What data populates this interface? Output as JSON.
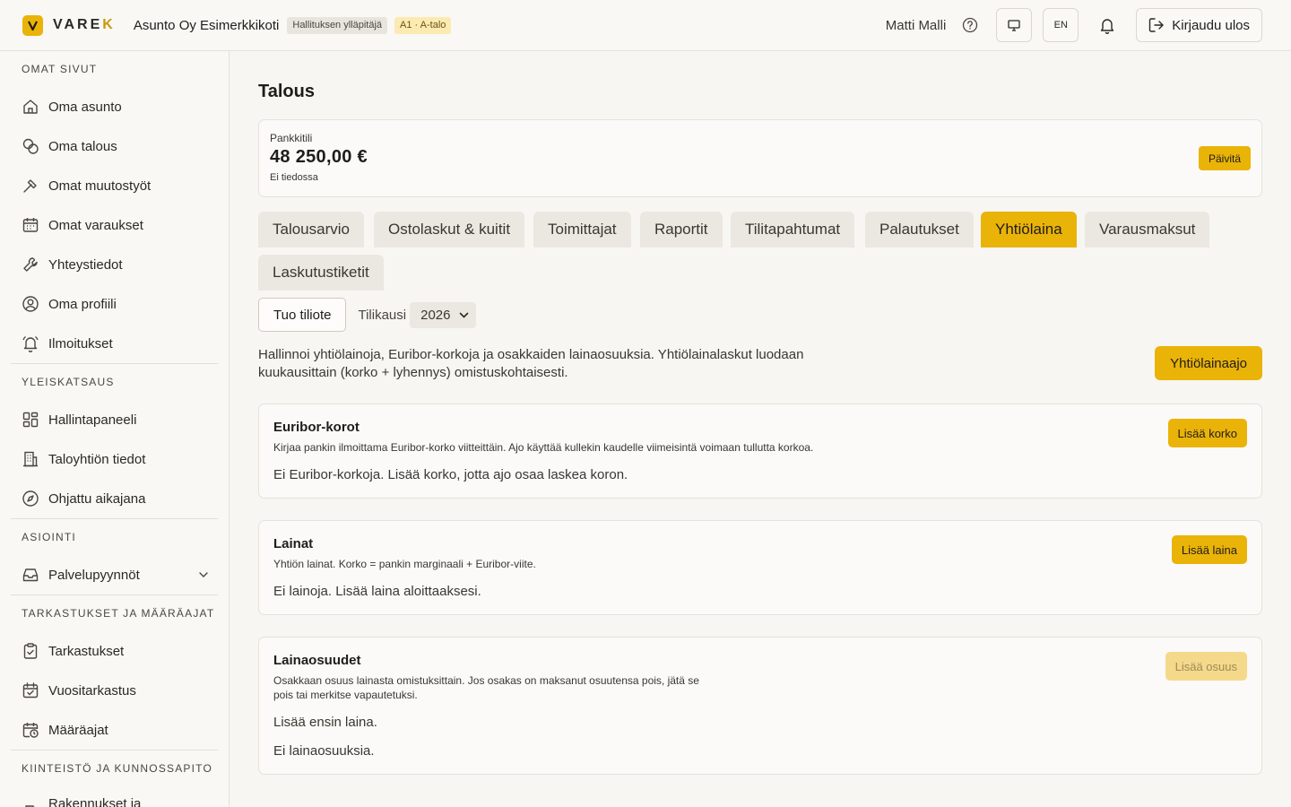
{
  "header": {
    "logo_text": "VARE",
    "logo_text_accent": "K",
    "org_name": "Asunto Oy Esimerkkikoti",
    "role_badge": "Hallituksen ylläpitäjä",
    "unit_badge": "A1 · A-talo",
    "user_name": "Matti Malli",
    "language": "EN",
    "logout_label": "Kirjaudu ulos"
  },
  "sidebar": {
    "sections": [
      {
        "title": "OMAT SIVUT",
        "items": [
          {
            "label": "Oma asunto",
            "icon": "home-icon"
          },
          {
            "label": "Oma talous",
            "icon": "coins-icon"
          },
          {
            "label": "Omat muutostyöt",
            "icon": "hammer-icon"
          },
          {
            "label": "Omat varaukset",
            "icon": "calendar-icon"
          },
          {
            "label": "Yhteystiedot",
            "icon": "wrench-icon"
          },
          {
            "label": "Oma profiili",
            "icon": "user-circle-icon"
          },
          {
            "label": "Ilmoitukset",
            "icon": "bell-ring-icon"
          }
        ]
      },
      {
        "title": "YLEISKATSAUS",
        "items": [
          {
            "label": "Hallintapaneeli",
            "icon": "dashboard-icon"
          },
          {
            "label": "Taloyhtiön tiedot",
            "icon": "building-icon"
          },
          {
            "label": "Ohjattu aikajana",
            "icon": "compass-icon"
          }
        ]
      },
      {
        "title": "ASIOINTI",
        "items": [
          {
            "label": "Palvelupyynnöt",
            "icon": "inbox-icon",
            "expandable": true
          }
        ]
      },
      {
        "title": "TARKASTUKSET JA MÄÄRÄAJAT",
        "items": [
          {
            "label": "Tarkastukset",
            "icon": "clipboard-check-icon"
          },
          {
            "label": "Vuositarkastus",
            "icon": "calendar-check-icon"
          },
          {
            "label": "Määräajat",
            "icon": "calendar-clock-icon"
          }
        ]
      },
      {
        "title": "KIINTEISTÖ JA KUNNOSSAPITO",
        "items": [
          {
            "label": "Rakennukset ja huoneistot",
            "icon": "door-icon",
            "expandable": true
          }
        ]
      }
    ]
  },
  "main": {
    "title": "Talous",
    "bank": {
      "label": "Pankkitili",
      "amount": "48 250,00 €",
      "note": "Ei tiedossa",
      "refresh_label": "Päivitä"
    },
    "tabs": [
      {
        "label": "Talousarvio",
        "active": false
      },
      {
        "label": "Ostolaskut & kuitit",
        "active": false
      },
      {
        "label": "Toimittajat",
        "active": false
      },
      {
        "label": "Raportit",
        "active": false
      },
      {
        "label": "Tilitapahtumat",
        "active": false
      },
      {
        "label": "Palautukset",
        "active": false
      },
      {
        "label": "Yhtiölaina",
        "active": true
      },
      {
        "label": "Varausmaksut",
        "active": false
      },
      {
        "label": "Laskutustiketit",
        "active": false
      }
    ],
    "import_label": "Tuo tiliote",
    "period_label": "Tilikausi",
    "period_value": "2026",
    "intro": "Hallinnoi yhtiölainoja, Euribor-korkoja ja osakkaiden lainaosuuksia. Yhtiölainalaskut luodaan kuukausittain (korko + lyhennys) omistuskohtaisesti.",
    "run_label": "Yhtiölainaajo",
    "cards": {
      "euribor": {
        "title": "Euribor-korot",
        "desc": "Kirjaa pankin ilmoittama Euribor-korko viitteittäin. Ajo käyttää kullekin kaudelle viimeisintä voimaan tullutta korkoa.",
        "empty": "Ei Euribor-korkoja. Lisää korko, jotta ajo osaa laskea koron.",
        "button": "Lisää korko"
      },
      "loans": {
        "title": "Lainat",
        "desc": "Yhtiön lainat. Korko = pankin marginaali + Euribor-viite.",
        "empty": "Ei lainoja. Lisää laina aloittaaksesi.",
        "button": "Lisää laina"
      },
      "shares": {
        "title": "Lainaosuudet",
        "desc": "Osakkaan osuus lainasta omistuksittain. Jos osakas on maksanut osuutensa pois, jätä se pois tai merkitse vapautetuksi.",
        "empty1": "Lisää ensin laina.",
        "empty2": "Ei lainaosuuksia.",
        "button": "Lisää osuus"
      }
    }
  },
  "colors": {
    "accent": "#eab308",
    "background": "#f7f6f2",
    "border": "#e5e2da"
  }
}
